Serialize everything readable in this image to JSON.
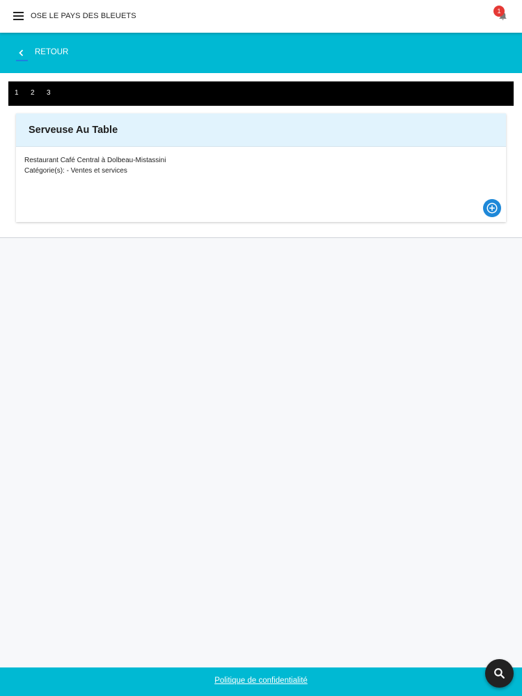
{
  "header": {
    "title": "OSE LE PAYS DES BLEUETS",
    "notification_count": "1"
  },
  "subbar": {
    "back_label": "RETOUR"
  },
  "pager": {
    "pages": [
      "1",
      "2",
      "3"
    ]
  },
  "job_card": {
    "title": "Serveuse Au Table",
    "location": "Restaurant Café Central à Dolbeau-Mistassini",
    "categories": "Catégorie(s): - Ventes et services"
  },
  "footer": {
    "privacy_label": "Politique de confidentialité"
  },
  "icons": {
    "menu": "menu-icon",
    "notifications": "bell-icon",
    "back": "chevron-left-icon",
    "add": "plus-circle-icon",
    "search": "search-icon"
  },
  "colors": {
    "accent": "#00b9d3",
    "pager_bg": "#000000",
    "card_header_bg": "#e1f3fd",
    "add_button": "#1e88d8",
    "badge": "#e53935",
    "fab": "#222222"
  }
}
